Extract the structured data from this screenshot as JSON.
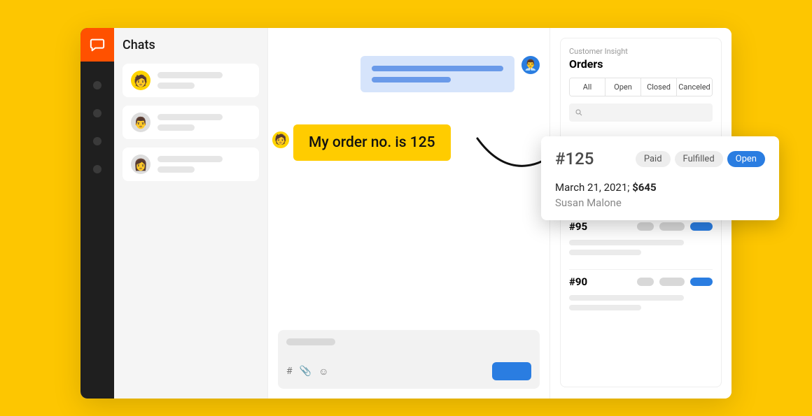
{
  "sidebar": {
    "title": "Chats"
  },
  "conversation": {
    "customer_message": "My order no. is 125"
  },
  "panel": {
    "subtitle": "Customer Insight",
    "title": "Orders",
    "tabs": [
      "All",
      "Open",
      "Closed",
      "Canceled"
    ]
  },
  "order_card": {
    "id": "#125",
    "badges": {
      "paid": "Paid",
      "fulfilled": "Fulfilled",
      "open": "Open"
    },
    "date": "March 21, 2021;",
    "amount": "$645",
    "customer": "Susan Malone"
  },
  "orders_mini": [
    {
      "id": "#95"
    },
    {
      "id": "#90"
    }
  ]
}
